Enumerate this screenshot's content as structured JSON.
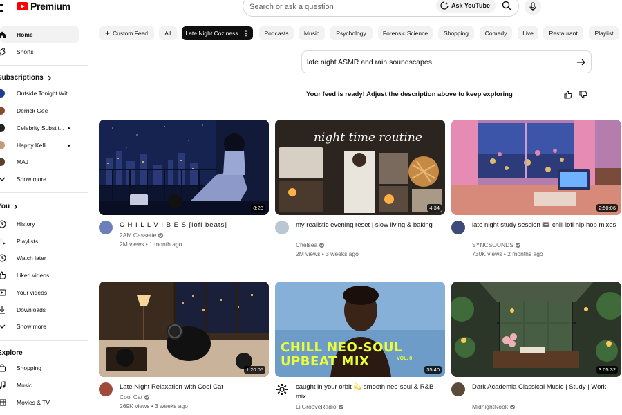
{
  "app": {
    "logo_text": "Premium",
    "brand_color": "#ff0000"
  },
  "search": {
    "placeholder": "Search or ask a question",
    "ask_label": "Ask YouTube"
  },
  "sidebar": {
    "primary": [
      {
        "label": "Home",
        "icon": "home-icon",
        "active": true
      },
      {
        "label": "Shorts",
        "icon": "shorts-icon"
      }
    ],
    "subscriptions_title": "Subscriptions",
    "subscriptions": [
      {
        "label": "Outside Tonight Wit...",
        "color": "#1f3b8f",
        "new": false
      },
      {
        "label": "Derrick Gee",
        "color": "#8a4b2d",
        "new": false
      },
      {
        "label": "Celebrity Substit...",
        "color": "#222222",
        "new": true
      },
      {
        "label": "Happy Kelli",
        "color": "#c49a7a",
        "new": true
      },
      {
        "label": "MAJ",
        "color": "#5a4030",
        "new": false
      }
    ],
    "show_more_1": "Show more",
    "you_title": "You",
    "you_items": [
      {
        "label": "History",
        "icon": "history-icon"
      },
      {
        "label": "Playlists",
        "icon": "playlists-icon"
      },
      {
        "label": "Watch later",
        "icon": "watch-later-icon"
      },
      {
        "label": "Liked videos",
        "icon": "liked-icon"
      },
      {
        "label": "Your videos",
        "icon": "your-videos-icon"
      },
      {
        "label": "Downloads",
        "icon": "downloads-icon"
      }
    ],
    "show_more_2": "Show more",
    "explore_title": "Explore",
    "explore_items": [
      {
        "label": "Shopping",
        "icon": "shopping-icon"
      },
      {
        "label": "Music",
        "icon": "music-icon"
      },
      {
        "label": "Movies & TV",
        "icon": "movies-icon"
      }
    ]
  },
  "chips": [
    {
      "label": "Custom Feed",
      "kind": "add"
    },
    {
      "label": "All"
    },
    {
      "label": "Late Night Coziness",
      "selected": true
    },
    {
      "label": "Podcasts"
    },
    {
      "label": "Music"
    },
    {
      "label": "Psychology"
    },
    {
      "label": "Forensic Science"
    },
    {
      "label": "Shopping"
    },
    {
      "label": "Comedy"
    },
    {
      "label": "Live"
    },
    {
      "label": "Restaurant"
    },
    {
      "label": "Playlist"
    }
  ],
  "feed": {
    "prompt_value": "late night ASMR and rain soundscapes",
    "ready_text": "Your feed is ready! Adjust the description above to keep exploring"
  },
  "videos": [
    {
      "title": "C H I L L  V I B E S [lofi beats]",
      "channel": "2AM Cassette",
      "verified": true,
      "views": "2M views",
      "age": "1 month ago",
      "duration": "8:23",
      "avatar_color": "#6d7fb8"
    },
    {
      "title": "my realistic evening reset | slow living & baking",
      "channel": "Chelsea",
      "verified": true,
      "views": "2M views",
      "age": "3 weeks ago",
      "duration": "4:34",
      "thumb_text": "night time routine",
      "avatar_color": "#b9c7d4"
    },
    {
      "title": "late night study session 📼 chill lofi hip hop mixes",
      "channel": "SYNCSOUNDS",
      "verified": true,
      "views": "730K views",
      "age": "2 months ago",
      "duration": "2:50:06",
      "avatar_color": "#3d4a7a"
    },
    {
      "title": "Late Night Relaxation with Cool Cat",
      "channel": "Cool Cat",
      "verified": true,
      "views": "269K views",
      "age": "3 weeks ago",
      "duration": "1:20:05",
      "avatar_color": "#a04a3a"
    },
    {
      "title": "caught in your orbit 💫 smooth neo-soul & R&B mix",
      "channel": "LilGrooveRadio",
      "verified": true,
      "views": "",
      "age": "",
      "duration": "35:40",
      "thumb_text": "CHILL NEO-SOUL UPBEAT MIX",
      "thumb_sub": "VOL. 8",
      "avatar_color": "#ffffff"
    },
    {
      "title": "Dark Academia Classical Music | Study | Work",
      "channel": "MidnightNook",
      "verified": true,
      "views": "",
      "age": "",
      "duration": "3:05:32",
      "avatar_color": "#5b4a3a"
    }
  ]
}
